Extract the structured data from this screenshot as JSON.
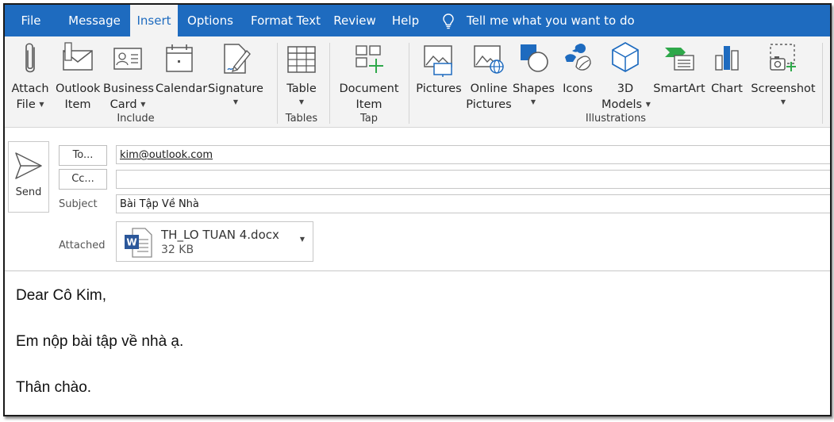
{
  "menu": {
    "tabs": [
      "File",
      "Message",
      "Insert",
      "Options",
      "Format Text",
      "Review",
      "Help"
    ],
    "active_tab": "Insert",
    "tell_me": "Tell me what you want to do"
  },
  "ribbon": {
    "include": {
      "label": "Include",
      "attach_file": [
        "Attach",
        "File"
      ],
      "outlook_item": [
        "Outlook",
        "Item"
      ],
      "business_card": [
        "Business",
        "Card"
      ],
      "calendar": "Calendar",
      "signature": "Signature"
    },
    "tables": {
      "label": "Tables",
      "table": "Table"
    },
    "tap": {
      "label": "Tap",
      "document_item": [
        "Document",
        "Item"
      ]
    },
    "illustrations": {
      "label": "Illustrations",
      "pictures": "Pictures",
      "online_pictures": [
        "Online",
        "Pictures"
      ],
      "shapes": "Shapes",
      "icons": "Icons",
      "models_3d": [
        "3D",
        "Models"
      ],
      "smartart": "SmartArt",
      "chart": "Chart",
      "screenshot": "Screenshot"
    }
  },
  "compose": {
    "send_label": "Send",
    "to_button": "To...",
    "cc_button": "Cc...",
    "to_value": "kim@outlook.com",
    "cc_value": "",
    "subject_label": "Subject",
    "subject_value": "Bài Tập Về Nhà",
    "attached_label": "Attached",
    "attachment": {
      "name": "TH_LO TUAN 4.docx",
      "size": "32 KB",
      "icon_letter": "W"
    }
  },
  "body": {
    "greeting": "Dear Cô Kim,",
    "line1": "Em nộp bài tập về nhà ạ.",
    "closing": "Thân chào."
  },
  "colors": {
    "menu_bar": "#1e6bbf",
    "ribbon_bg": "#f3f3f3",
    "accent_green": "#2ea84a",
    "accent_blue": "#1e6bbf"
  }
}
